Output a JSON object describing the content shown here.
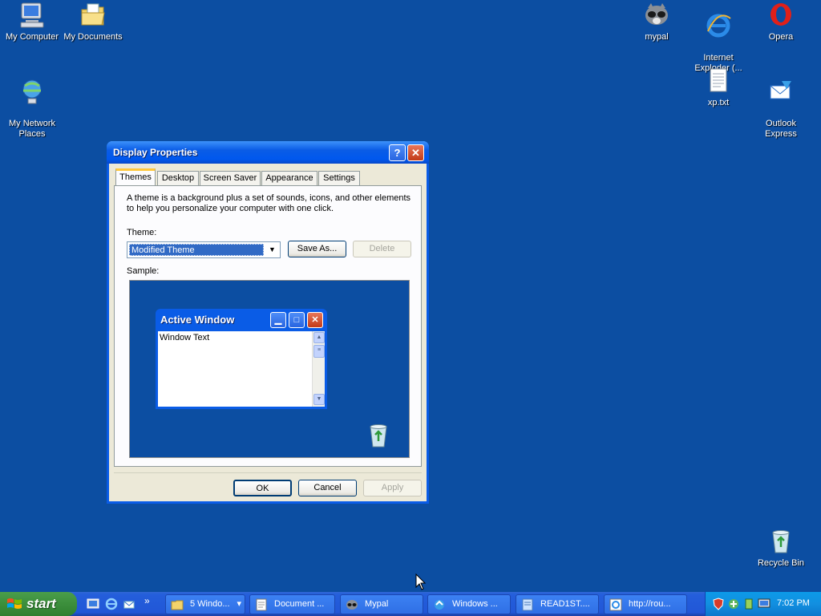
{
  "desktop": {
    "icons": [
      {
        "label": "My Computer"
      },
      {
        "label": "My Documents"
      },
      {
        "label": "My Network\nPlaces"
      },
      {
        "label": "mypal"
      },
      {
        "label": "Internet\nExploder (..."
      },
      {
        "label": "Opera"
      },
      {
        "label": "xp.txt"
      },
      {
        "label": "Outlook\nExpress"
      },
      {
        "label": "Recycle Bin"
      }
    ]
  },
  "dialog": {
    "title": "Display Properties",
    "help_label": "?",
    "close_label": "✕",
    "tabs": [
      "Themes",
      "Desktop",
      "Screen Saver",
      "Appearance",
      "Settings"
    ],
    "description": "A theme is a background plus a set of sounds, icons, and other elements to help you personalize your computer with one click.",
    "theme_label": "Theme:",
    "theme_value": "Modified Theme",
    "save_as_label": "Save As...",
    "delete_label": "Delete",
    "sample_label": "Sample:",
    "sample": {
      "window_title": "Active Window",
      "window_text": "Window Text"
    },
    "ok_label": "OK",
    "cancel_label": "Cancel",
    "apply_label": "Apply"
  },
  "taskbar": {
    "start_label": "start",
    "overflow_label": "»",
    "items": [
      {
        "label": "5 Windo...",
        "dropdown": "▾"
      },
      {
        "label": "Document ..."
      },
      {
        "label": "Mypal"
      },
      {
        "label": "Windows ..."
      },
      {
        "label": "READ1ST...."
      },
      {
        "label": "http://rou..."
      }
    ],
    "clock": "7:02 PM"
  },
  "colors": {
    "desktop": "#0c4ea2",
    "titlebar": "#0a5ce6",
    "dialog_face": "#ece9d8",
    "taskbar": "#245edb",
    "start": "#3c8f3c"
  }
}
